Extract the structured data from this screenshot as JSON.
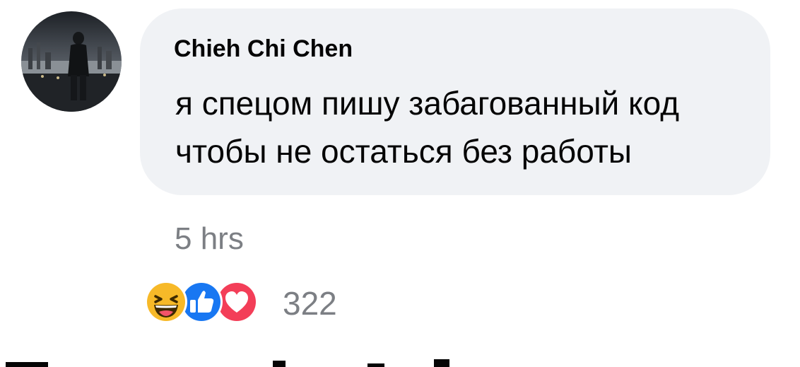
{
  "comment": {
    "author": "Chieh Chi Chen",
    "lines": [
      "я спецом пишу забагованный код",
      "чтобы не остаться без работы"
    ],
    "timestamp": "5 hrs",
    "reaction_count": "322",
    "reactions": [
      "haha-reaction-icon",
      "like-reaction-icon",
      "love-reaction-icon"
    ]
  },
  "colors": {
    "bubble": "#f0f2f5",
    "text": "#050505",
    "meta_text": "#7c7f84",
    "like_blue": "#1877f2",
    "love_red": "#f33e58",
    "haha_yellow": "#f7b928"
  }
}
